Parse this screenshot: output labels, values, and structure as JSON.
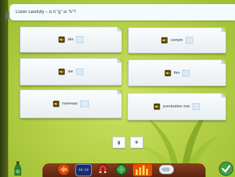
{
  "instruction": "Listen carefully – is it \"g\" or \"k\"?",
  "cards": [
    {
      "word": "das"
    },
    {
      "word": "campin"
    },
    {
      "word": "dar"
    },
    {
      "word": "thin"
    },
    {
      "word": "homewar"
    },
    {
      "word": "punctuation mar"
    }
  ],
  "letters": [
    "g",
    "k"
  ],
  "toolbar": {
    "clock_display": "00:00"
  },
  "colors": {
    "board": "#b8d24a",
    "banner": "#f4fbff",
    "slot": "#dceaf6",
    "toolbar_wood": "#6e2e15"
  },
  "icons": [
    "speaker-icon",
    "bottle-icon",
    "arrow-icon",
    "clock-icon",
    "horseshoe-magnet-icon",
    "globe-icon",
    "bar-chart-icon",
    "toggle-icon",
    "checkmark-icon",
    "paperclip-icon"
  ]
}
